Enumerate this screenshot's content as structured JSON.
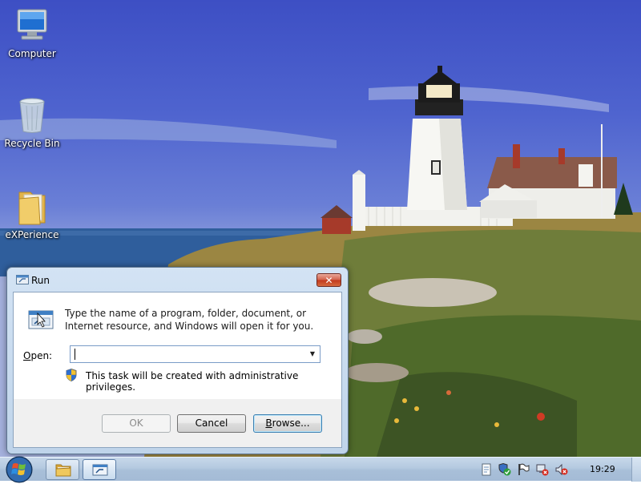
{
  "desktop": {
    "icons": [
      {
        "name": "computer-icon",
        "label": "Computer"
      },
      {
        "name": "recycle-bin-icon",
        "label": "Recycle Bin"
      },
      {
        "name": "folder-icon",
        "label": "eXPerience"
      }
    ]
  },
  "run_dialog": {
    "title": "Run",
    "close_glyph": "✕",
    "description": "Type the name of a program, folder, document, or Internet resource, and Windows will open it for you.",
    "open_label_prefix": "",
    "open_label_access_key": "O",
    "open_label_suffix": "pen:",
    "open_value": "",
    "admin_note": "This task will be created with administrative privileges.",
    "buttons": {
      "ok": "OK",
      "cancel": "Cancel",
      "browse_access_key": "B",
      "browse_rest": "rowse..."
    }
  },
  "taskbar": {
    "clock": "19:29",
    "buttons": [
      {
        "name": "explorer-taskbar-button",
        "icon": "folder-icon"
      },
      {
        "name": "run-taskbar-button",
        "icon": "run-icon",
        "active": true
      }
    ],
    "tray_icons": [
      "action-center-icon",
      "security-check-icon",
      "flag-icon",
      "network-icon",
      "volume-muted-icon"
    ]
  },
  "colors": {
    "title_bar": "#bfd4ea",
    "close_button": "#c23a1e",
    "taskbar": "#b4c9e0"
  }
}
